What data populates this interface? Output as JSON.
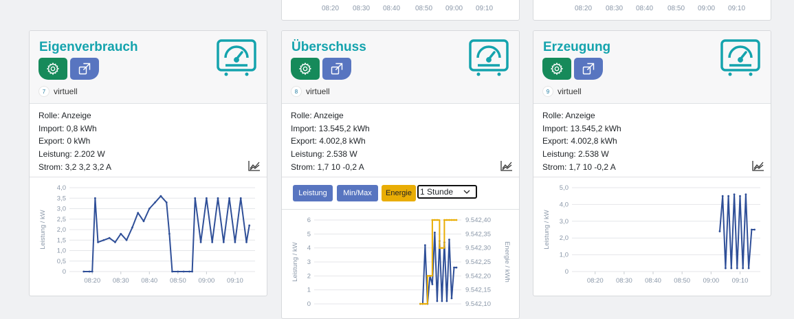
{
  "top_cards": {
    "ticks": [
      "08:20",
      "08:30",
      "08:40",
      "08:50",
      "09:00",
      "09:10"
    ]
  },
  "cards": [
    {
      "title": "Eigenverbrauch",
      "id_num": "7",
      "virtual_label": "virtuell",
      "info": [
        "Rolle: Anzeige",
        "Import: 0,8 kWh",
        "Export: 0 kWh",
        "Leistung: 2.202 W",
        "Strom: 3,2 3,2 3,2 A"
      ]
    },
    {
      "title": "Überschuss",
      "id_num": "8",
      "virtual_label": "virtuell",
      "info": [
        "Rolle: Anzeige",
        "Import: 13.545,2 kWh",
        "Export: 4.002,8 kWh",
        "Leistung: 2.538 W",
        "Strom: 1,7 10 -0,2 A"
      ],
      "chart_controls": {
        "btn_power": "Leistung",
        "btn_minmax": "Min/Max",
        "btn_energy": "Energie",
        "range_select": "1 Stunde"
      }
    },
    {
      "title": "Erzeugung",
      "id_num": "9",
      "virtual_label": "virtuell",
      "info": [
        "Rolle: Anzeige",
        "Import: 13.545,2 kWh",
        "Export: 4.002,8 kWh",
        "Leistung: 2.538 W",
        "Strom: 1,7 10 -0,2 A"
      ]
    }
  ],
  "colors": {
    "accent": "#14a3ad",
    "gear_btn": "#168a5a",
    "link_btn": "#5875c0",
    "energy_btn": "#e9ad05",
    "series_power": "#2f4f98",
    "series_energy": "#e9ad05"
  },
  "chart_data": [
    {
      "type": "line",
      "ylabel": "Leistung / kW",
      "ylim": [
        0,
        4.0
      ],
      "yticks": [
        "0",
        "0,5",
        "1,0",
        "1,5",
        "2,0",
        "2,5",
        "3,0",
        "3,5",
        "4,0"
      ],
      "xticks": [
        "08:20",
        "08:30",
        "08:40",
        "08:50",
        "09:00",
        "09:10"
      ],
      "series": [
        {
          "x": [
            "08:17",
            "08:19",
            "08:20",
            "08:21",
            "08:22",
            "08:24",
            "08:26",
            "08:28",
            "08:30",
            "08:32",
            "08:34",
            "08:36",
            "08:38",
            "08:40",
            "08:42",
            "08:44",
            "08:46",
            "08:47",
            "08:48",
            "08:50",
            "08:52",
            "08:54",
            "08:55",
            "08:56",
            "08:58",
            "09:00",
            "09:02",
            "09:04",
            "09:06",
            "09:08",
            "09:10",
            "09:12",
            "09:14",
            "09:15"
          ],
          "values": [
            0,
            0,
            0,
            3.5,
            1.4,
            1.5,
            1.6,
            1.4,
            1.8,
            1.5,
            2.1,
            2.8,
            2.4,
            3.0,
            3.3,
            3.6,
            3.3,
            1.8,
            0,
            0,
            0,
            0,
            0,
            3.5,
            1.4,
            3.5,
            1.4,
            3.5,
            1.4,
            3.5,
            1.4,
            3.5,
            1.4,
            2.2
          ]
        }
      ]
    },
    {
      "type": "line",
      "ylabel": "Leistung / kW",
      "y2label": "Energie / kWh",
      "ylim": [
        0,
        6
      ],
      "y2lim": [
        9542.1,
        9542.4
      ],
      "yticks": [
        "0",
        "1",
        "2",
        "3",
        "4",
        "5",
        "6"
      ],
      "y2ticks": [
        "9.542,10",
        "9.542,15",
        "9.542,20",
        "9.542,25",
        "9.542,30",
        "9.542,35",
        "9.542,40"
      ],
      "series": [
        {
          "name": "",
          "axis": "left",
          "x": [
            "09:00",
            "09:01",
            "09:02",
            "09:03",
            "09:04",
            "09:05",
            "09:06",
            "09:07",
            "09:08",
            "09:09",
            "09:10",
            "09:11",
            "09:12",
            "09:13",
            "09:14",
            "09:15"
          ],
          "values": [
            0,
            0,
            4.2,
            0,
            2.0,
            1.4,
            5.1,
            0.2,
            4.5,
            0.2,
            4.4,
            0.2,
            4.6,
            0.4,
            2.6,
            2.6
          ]
        },
        {
          "name": "",
          "axis": "right",
          "x": [
            "09:00",
            "09:01",
            "09:02",
            "09:03",
            "09:04",
            "09:05",
            "09:06",
            "09:07",
            "09:08",
            "09:09",
            "09:10",
            "09:11",
            "09:12",
            "09:13",
            "09:14",
            "09:15"
          ],
          "values": [
            9542.1,
            9542.1,
            9542.1,
            9542.2,
            9542.2,
            9542.4,
            9542.4,
            9542.4,
            9542.3,
            9542.3,
            9542.4,
            9542.4,
            9542.4,
            9542.4,
            9542.4,
            9542.4
          ]
        }
      ]
    },
    {
      "type": "line",
      "ylabel": "Leistung / kW",
      "ylim": [
        0,
        5.0
      ],
      "yticks": [
        "0",
        "1,0",
        "2,0",
        "3,0",
        "4,0",
        "5,0"
      ],
      "xticks": [
        "08:20",
        "08:30",
        "08:40",
        "08:50",
        "09:00",
        "09:10"
      ],
      "series": [
        {
          "x": [
            "09:03",
            "09:04",
            "09:05",
            "09:06",
            "09:07",
            "09:08",
            "09:09",
            "09:10",
            "09:11",
            "09:12",
            "09:13",
            "09:14",
            "09:15"
          ],
          "values": [
            2.4,
            4.5,
            0.2,
            4.5,
            0.2,
            4.6,
            0.2,
            4.5,
            0.2,
            4.6,
            0.2,
            2.5,
            2.5
          ]
        }
      ]
    }
  ]
}
